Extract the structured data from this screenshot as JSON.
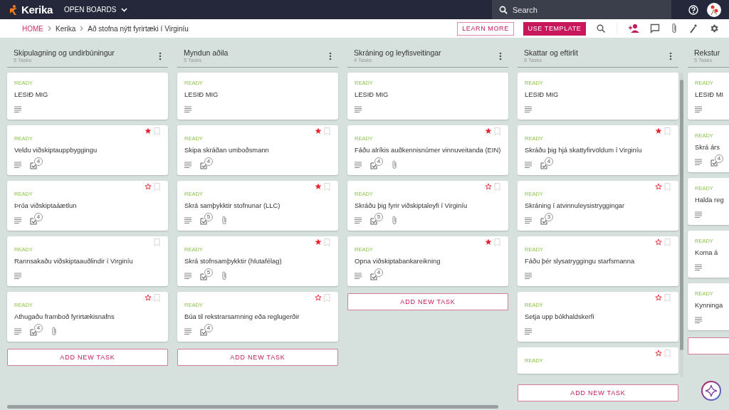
{
  "topbar": {
    "logo": "Kerika",
    "boards_menu": "OPEN BOARDS",
    "search": {
      "placeholder": "Search"
    }
  },
  "breadcrumb": [
    {
      "label": "HOME",
      "kind": "link"
    },
    {
      "label": "Kerika",
      "kind": "crumb"
    },
    {
      "label": "Að stofna nýtt fyrirtæki í Virginíu",
      "kind": "crumb"
    }
  ],
  "actions": {
    "learn_more": "LEARN MORE",
    "use_template": "USE TEMPLATE"
  },
  "columns": [
    {
      "title": "Skipulagning og undirbúningur",
      "count": "5 Tasks",
      "add_label": "ADD NEW TASK",
      "tasks": [
        {
          "kind": "readme",
          "status": "READY",
          "title": "LESIÐ MIG"
        },
        {
          "kind": "task",
          "status": "READY",
          "title": "Veldu viðskiptauppbyggingu",
          "starred": true,
          "bookmark": true,
          "checklist": "4"
        },
        {
          "kind": "task",
          "status": "READY",
          "title": "Þróa viðskiptaáætlun",
          "starred": false,
          "bookmark": true,
          "checklist": "4"
        },
        {
          "kind": "task",
          "status": "READY",
          "title": "Rannsakaðu viðskiptaauðlindir í Virginíu",
          "bookmark": true
        },
        {
          "kind": "task",
          "status": "READY",
          "title": "Athugaðu framboð fyrirtækisnafns",
          "starred": false,
          "bookmark": true,
          "checklist": "4",
          "attachment": true
        }
      ]
    },
    {
      "title": "Myndun aðila",
      "count": "5 Tasks",
      "add_label": "ADD NEW TASK",
      "tasks": [
        {
          "kind": "readme",
          "status": "READY",
          "title": "LESIÐ MIG"
        },
        {
          "kind": "task",
          "status": "READY",
          "title": "Skipa skráðan umboðsmann",
          "starred": true,
          "bookmark": true,
          "checklist": "4"
        },
        {
          "kind": "task",
          "status": "READY",
          "title": "Skrá samþykktir stofnunar (LLC)",
          "starred": true,
          "bookmark": true,
          "checklist": "5",
          "attachment": true
        },
        {
          "kind": "task",
          "status": "READY",
          "title": "Skrá stofnsamþykktir (hlutafélag)",
          "starred": true,
          "bookmark": true,
          "checklist": "5",
          "attachment": true
        },
        {
          "kind": "task",
          "status": "READY",
          "title": "Búa til rekstrarsamning eða reglugerðir",
          "starred": false,
          "bookmark": true,
          "checklist": "4"
        }
      ]
    },
    {
      "title": "Skráning og leyfisveitingar",
      "count": "4 Tasks",
      "add_label": "ADD NEW TASK",
      "tasks": [
        {
          "kind": "readme",
          "status": "READY",
          "title": "LESIÐ MIG"
        },
        {
          "kind": "task",
          "status": "READY",
          "title": "Fáðu alríkis auðkennisnúmer vinnuveitanda (EIN)",
          "starred": true,
          "bookmark": true,
          "checklist": "4",
          "attachment": true
        },
        {
          "kind": "task",
          "status": "READY",
          "title": "Skráðu þig fyrir viðskiptaleyfi í Virginíu",
          "starred": false,
          "bookmark": true,
          "checklist": "5",
          "attachment": true
        },
        {
          "kind": "task",
          "status": "READY",
          "title": "Opna viðskiptabankareikning",
          "starred": true,
          "bookmark": true,
          "checklist": "4"
        }
      ]
    },
    {
      "title": "Skattar og eftirlit",
      "count": "6 Tasks",
      "add_label": "ADD NEW TASK",
      "tasks": [
        {
          "kind": "readme",
          "status": "READY",
          "title": "LESIÐ MIG"
        },
        {
          "kind": "task",
          "status": "READY",
          "title": "Skráðu þig hjá skattyfirvöldum í Virginíu",
          "starred": true,
          "bookmark": true,
          "checklist": "4"
        },
        {
          "kind": "task",
          "status": "READY",
          "title": "Skráning í atvinnuleysistryggingar",
          "starred": false,
          "bookmark": true,
          "checklist": "3"
        },
        {
          "kind": "task",
          "status": "READY",
          "title": "Fáðu þér slysatryggingu starfsmanna",
          "starred": false,
          "bookmark": true
        },
        {
          "kind": "task",
          "status": "READY",
          "title": "Setja upp bókhaldskerfi",
          "starred": false,
          "bookmark": true
        },
        {
          "kind": "task",
          "status": "READY",
          "starred": false,
          "bookmark": true
        }
      ]
    },
    {
      "title": "Rekstur",
      "count": "5 Tasks",
      "tasks": [
        {
          "kind": "readme",
          "status": "READY",
          "title": "LESIÐ MI"
        },
        {
          "kind": "task",
          "status": "READY",
          "title": "Skrá árs",
          "checklist": "4"
        },
        {
          "kind": "task",
          "status": "READY",
          "title": "Halda reg"
        },
        {
          "kind": "task",
          "status": "READY",
          "title": "Koma á"
        },
        {
          "kind": "task",
          "status": "READY",
          "title": "Kynninga"
        }
      ]
    }
  ]
}
